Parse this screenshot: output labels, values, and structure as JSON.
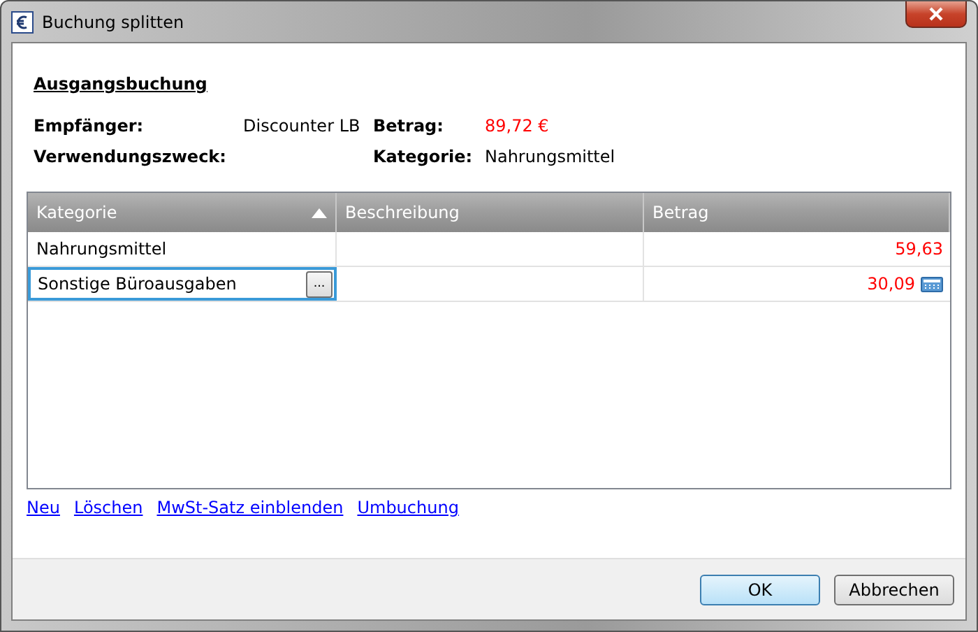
{
  "window": {
    "title": "Buchung splitten"
  },
  "section_title": "Ausgangsbuchung",
  "info_rows": [
    {
      "items": [
        {
          "label": "Empfänger:",
          "value": "Discounter LB",
          "kind": "text"
        },
        {
          "label": "Betrag:",
          "value": "89,72 €",
          "kind": "amount"
        }
      ]
    },
    {
      "items": [
        {
          "label": "Verwendungszweck:"
        },
        {
          "label": "Kategorie:",
          "value": "Nahrungsmittel",
          "kind": "text"
        }
      ]
    }
  ],
  "table": {
    "columns": [
      {
        "label": "Kategorie",
        "sorted": true
      },
      {
        "label": "Beschreibung",
        "sorted": false
      },
      {
        "label": "Betrag",
        "sorted": false
      }
    ],
    "rows": [
      {
        "kategorie": "Nahrungsmittel",
        "betrag": "59,63",
        "editing": false
      },
      {
        "kategorie": "Sonstige Büroausgaben",
        "betrag": "30,09",
        "editing": true,
        "browse_label": "..."
      }
    ]
  },
  "links": [
    "Neu",
    "Löschen",
    "MwSt-Satz einblenden",
    "Umbuchung"
  ],
  "buttons": [
    {
      "label": "OK",
      "default": true
    },
    {
      "label": "Abbrechen",
      "default": false
    }
  ]
}
